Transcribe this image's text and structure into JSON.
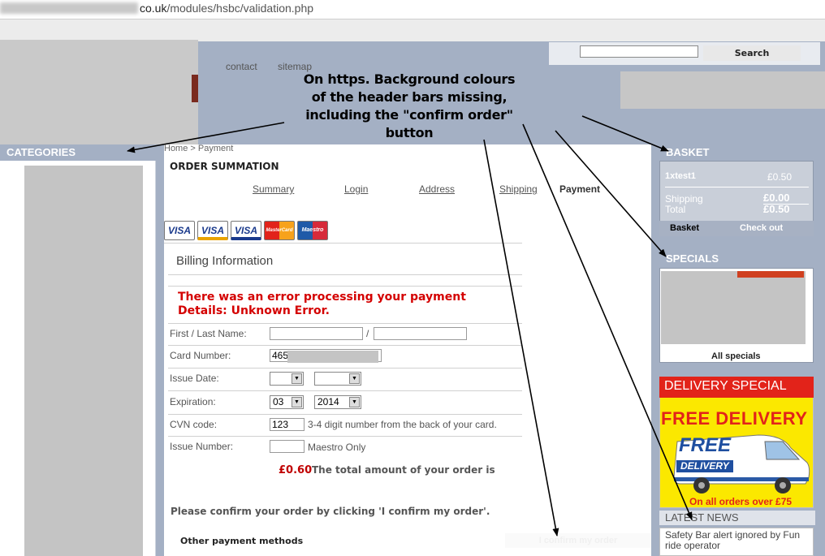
{
  "browser": {
    "url_host_suffix": "co.uk",
    "url_path": "/modules/hsbc/validation.php"
  },
  "header": {
    "links": [
      "contact",
      "sitemap"
    ],
    "search_button": "Search"
  },
  "annotation": {
    "lines": [
      "On https. Background colours",
      "of the header bars missing,",
      "including the \"confirm order\"",
      "button"
    ]
  },
  "sidebar_left": {
    "categories_title": "CATEGORIES"
  },
  "main": {
    "breadcrumb": "Home  >  Payment",
    "title": "ORDER SUMMATION",
    "steps": [
      "Summary",
      "Login",
      "Address",
      "Shipping",
      "Payment"
    ],
    "cards": [
      "VISA",
      "VISA",
      "VISA",
      "MasterCard",
      "Maestro"
    ],
    "billing_heading": "Billing Information",
    "error_line1": "There was an error processing your payment",
    "error_line2": "Details: Unknown Error.",
    "fields": {
      "name_label": "First / Last Name:",
      "name_separator": "/",
      "card_label": "Card Number:",
      "card_value_prefix": "465",
      "issue_date_label": "Issue Date:",
      "expiration_label": "Expiration:",
      "exp_month": "03",
      "exp_year": "2014",
      "cvn_label": "CVN code:",
      "cvn_value": "123",
      "cvn_hint": "3-4 digit number from the back of your card.",
      "issue_number_label": "Issue Number:",
      "issue_number_hint": "Maestro Only"
    },
    "amount": "£0.60",
    "amount_text": "The total amount of your order is",
    "confirm_instruction": "Please confirm your order by clicking 'I confirm my order'.",
    "other_methods": "Other payment methods",
    "confirm_button": "I confirm my order"
  },
  "sidebar_right": {
    "basket_title": "BASKET",
    "basket_item": "1xtest1",
    "basket_item_price": "£0.50",
    "shipping_label": "Shipping",
    "shipping_value": "£0.00",
    "total_label": "Total",
    "total_value": "£0.50",
    "basket_link": "Basket",
    "checkout_link": "Check out",
    "specials_title": "SPECIALS",
    "all_specials": "All specials",
    "delivery_heading": "DELIVERY SPECIAL",
    "free_delivery": "FREE DELIVERY",
    "van_text_1": "FREE",
    "van_text_2": "DELIVERY",
    "delivery_note": "On all orders over £75",
    "news_title": "LATEST NEWS",
    "news_item": "Safety Bar alert ignored by Fun ride operator"
  },
  "colors": {
    "page_bg": "#a4b0c4",
    "error_red": "#d40000",
    "delivery_red": "#e2231a",
    "delivery_yellow": "#fbe800"
  }
}
